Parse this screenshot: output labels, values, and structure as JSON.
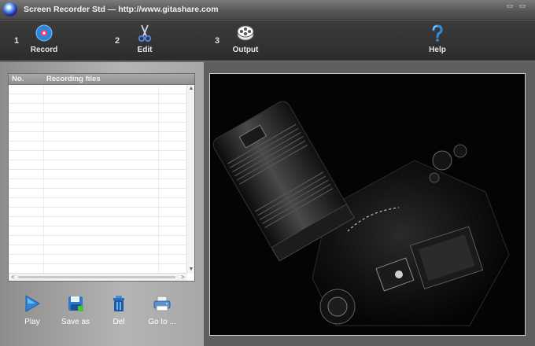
{
  "window": {
    "title": "Screen Recorder Std — http://www.gitashare.com",
    "icon": "globe-icon"
  },
  "toolbar": {
    "steps": [
      {
        "number": "1",
        "label": "Record",
        "icon": "record-disc-icon"
      },
      {
        "number": "2",
        "label": "Edit",
        "icon": "scissors-icon"
      },
      {
        "number": "3",
        "label": "Output",
        "icon": "film-reel-icon"
      }
    ],
    "help": {
      "label": "Help",
      "icon": "question-mark-icon"
    }
  },
  "recordings": {
    "columns": [
      "No.",
      "Recording files"
    ],
    "rows": []
  },
  "actions": [
    {
      "label": "Play",
      "icon": "play-icon"
    },
    {
      "label": "Save as",
      "icon": "floppy-disk-icon"
    },
    {
      "label": "Del",
      "icon": "trash-can-icon"
    },
    {
      "label": "Go to ...",
      "icon": "printer-folder-icon"
    }
  ],
  "preview": {
    "content": "camera-image"
  },
  "colors": {
    "accent": "#2a86d6",
    "toolbar": "#333333",
    "panel": "#a8a8a8"
  }
}
